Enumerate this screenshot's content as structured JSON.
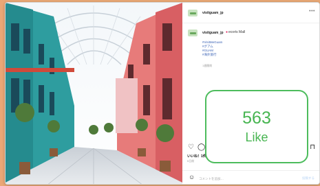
{
  "post": {
    "username": "visitguam_jp",
    "location": "ecorts Mall",
    "more_label": "•••",
    "hashtags": [
      "#VisitMeGuam",
      "#グアム",
      "#GUAM",
      "#海外旅行"
    ],
    "posted_ago": "1週間前",
    "likes_line": "いいね！1件",
    "date": "5日前"
  },
  "comment": {
    "placeholder": "コメントを追加…",
    "post_label": "投稿する"
  },
  "overlay": {
    "count": "563",
    "label": "Like"
  },
  "colors": {
    "overlay_accent": "#4cbc5c",
    "page_background": "#e9a875",
    "location_pin": "#e0245e"
  },
  "icons": [
    "heart-icon",
    "comment-icon",
    "bookmark-icon",
    "emoji-icon",
    "more-icon",
    "location-pin-icon"
  ]
}
